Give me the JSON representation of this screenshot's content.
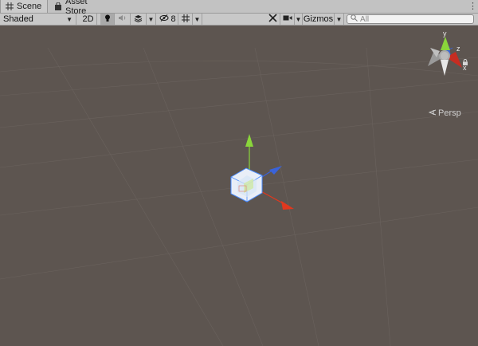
{
  "tabs": [
    {
      "label": "Scene",
      "icon": "grid-icon",
      "active": true
    },
    {
      "label": "Asset Store",
      "icon": "shopping-bag-icon",
      "active": false
    }
  ],
  "toolbar": {
    "draw_mode": "Shaded",
    "mode_2d": "2D",
    "hidden_count": "8",
    "gizmos": "Gizmos",
    "search_placeholder": "All"
  },
  "gizmo": {
    "axis_y": "y",
    "axis_z": "z",
    "axis_x": "x",
    "projection": "Persp"
  },
  "colors": {
    "background": "#5d5550",
    "axis_x": "#e0381e",
    "axis_y": "#8ad63b",
    "axis_z": "#3a63d9"
  }
}
